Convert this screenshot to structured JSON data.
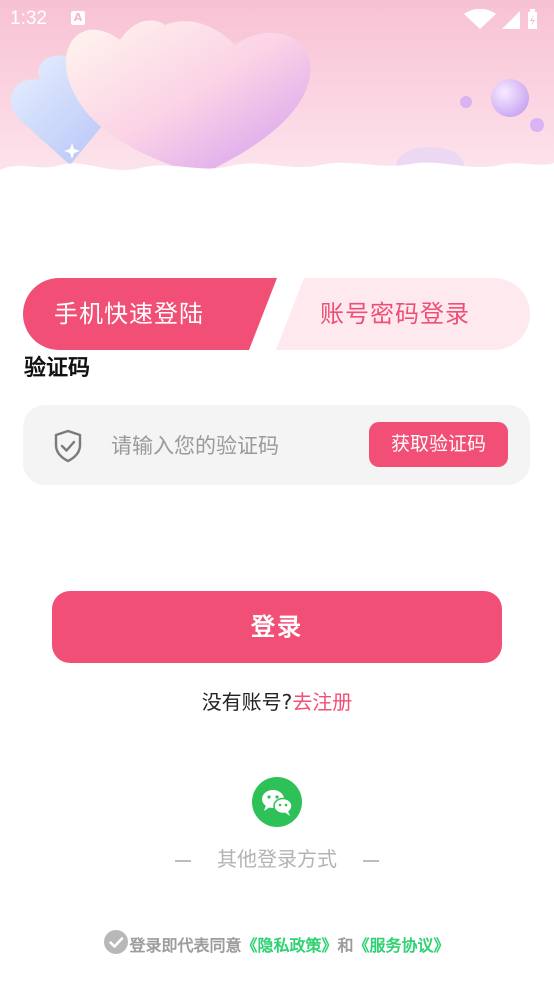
{
  "status_bar": {
    "time": "1:32",
    "notification_glyph": "A"
  },
  "tabs": {
    "phone_quick_login": "手机快速登陆",
    "account_password_login": "账号密码登录"
  },
  "code_heading": "验证码",
  "code_field": {
    "placeholder": "请输入您的验证码",
    "value": ""
  },
  "get_code_button": "获取验证码",
  "login_button": "登录",
  "register": {
    "question": "没有账号?",
    "link": "去注册"
  },
  "other_login_label": "其他登录方式",
  "agreement": {
    "prefix": "登录即代表同意",
    "privacy_policy": "《隐私政策》",
    "and": "和",
    "service_agreement": "《服务协议》"
  },
  "colors": {
    "accent": "#f24f76",
    "tab_inactive_bg": "#fde9ee",
    "wechat": "#2ec158",
    "policy_link": "#2fd273"
  },
  "icons": {
    "code_field": "shield-check-icon",
    "social": "wechat-icon",
    "agreement": "check-circle-icon"
  }
}
